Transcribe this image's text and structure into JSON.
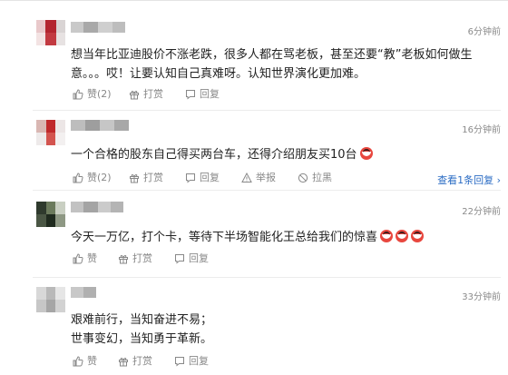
{
  "comments": [
    {
      "time": "6分钟前",
      "text_line1": "想当年比亚迪股价不涨老跌，很多人都在骂老板，甚至还要“教”老板如何做生",
      "text_line2": "意。。。哎！让要认知自己真难呀。认知世界演化更加难。",
      "like_label": "赞(2)",
      "reward_label": "打赏",
      "reply_label": "回复"
    },
    {
      "time": "16分钟前",
      "text_line1": "一个合格的股东自己得买两台车，还得介绍朋友买10台",
      "like_label": "赞(2)",
      "reward_label": "打赏",
      "reply_label": "回复",
      "report_label": "举报",
      "block_label": "拉黑",
      "view_replies_label": "查看1条回复 ›"
    },
    {
      "time": "22分钟前",
      "text_line1": "今天一万亿，打个卡，等待下半场智能化王总给我们的惊喜",
      "like_label": "赞",
      "reward_label": "打赏",
      "reply_label": "回复"
    },
    {
      "time": "33分钟前",
      "text_line1": "艰难前行，当知奋进不易；",
      "text_line2": "世事变幻，当知勇于革新。",
      "like_label": "赞",
      "reward_label": "打赏",
      "reply_label": "回复"
    }
  ],
  "icons": {
    "like": "thumbs-up-icon",
    "reward": "gift-icon",
    "reply": "reply-bubble-icon",
    "report": "warning-icon",
    "block": "block-icon",
    "emoji": "grinning-face-icon"
  },
  "colors": {
    "link": "#2b6cc4",
    "muted": "#888888",
    "emoji": "#e8473e"
  }
}
